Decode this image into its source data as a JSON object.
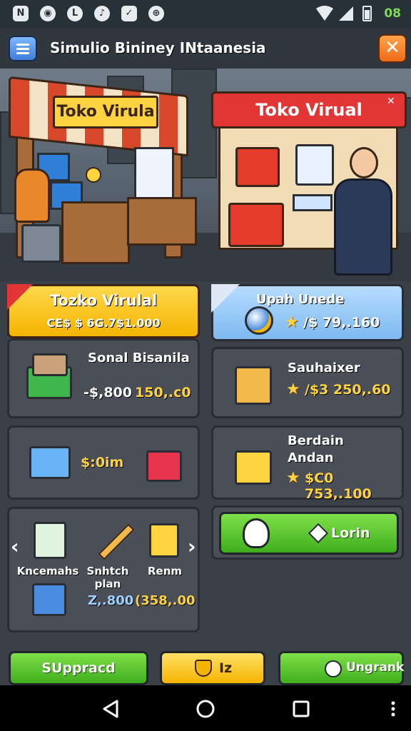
{
  "status_bar": {
    "icons": [
      "n-notification-icon",
      "record-icon",
      "l-notification-icon",
      "music-icon",
      "checkbox-icon",
      "target-icon"
    ],
    "icon_glyphs": [
      "N",
      "◉",
      "L",
      "♪",
      "✓",
      "⊕"
    ],
    "clock": "08"
  },
  "header": {
    "title": "Simulio Bininey INtaanesia",
    "close_label": "✕"
  },
  "scene": {
    "left_sign": "Toko Virula",
    "right_sign": "Toko Virual",
    "right_sign_close": "✕"
  },
  "cards": {
    "shop": {
      "title": "Tozko Virulal",
      "price": "CE$ $ 6G.7$1.000"
    },
    "upah": {
      "title": "Upah Unede",
      "price": "/$ 79,.160"
    },
    "sonal": {
      "title": "Sonal Bisanila",
      "price_neg": "-$,800",
      "price": "150,.c0"
    },
    "sauhaixer": {
      "title": "Sauhaixer",
      "price": "/$3 250,.60"
    },
    "money": {
      "price": "$:0im"
    },
    "berdain": {
      "title_line1": "Berdain",
      "title_line2": "Andan",
      "price": "$C0 753,.100"
    },
    "items": {
      "arrow_left": "‹",
      "arrow_right": "›",
      "item1_label": "Kncemahs",
      "item2_label_line1": "Snhtch",
      "item2_label_line2": "plan",
      "item3_label": "Renm",
      "price_a": "Z,.800",
      "price_b": "(358,.00"
    },
    "login": {
      "label": "Lorin"
    }
  },
  "bottom": {
    "btn1": "SUppracd",
    "btn2": "Iz",
    "btn3": "Ungrank"
  },
  "colors": {
    "accent_yellow": "#ffd23f",
    "accent_green": "#5ecb2a",
    "accent_orange": "#f06b17",
    "accent_blue": "#8cc8ff"
  }
}
